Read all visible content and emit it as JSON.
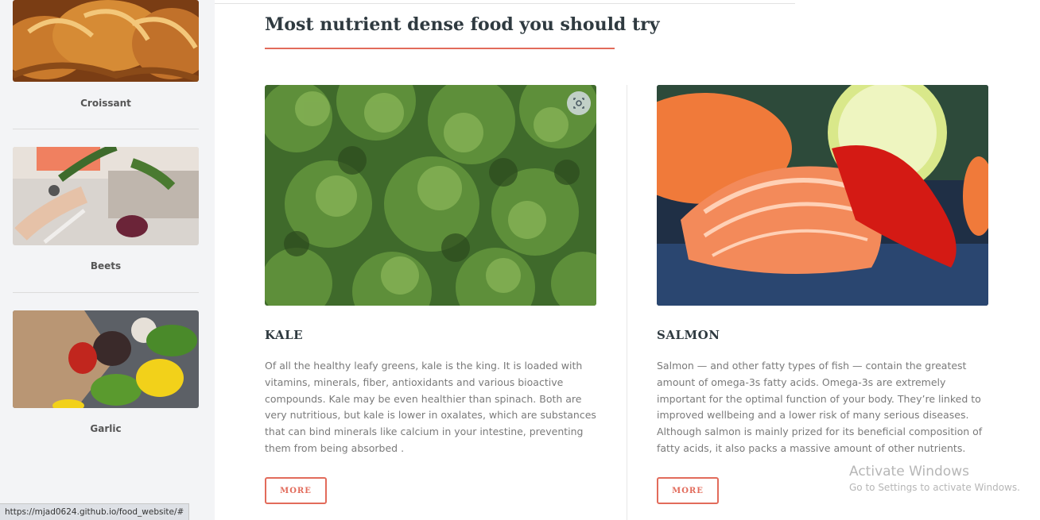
{
  "sidebar": {
    "items": [
      {
        "label": "Croissant",
        "image": "croissant-photo"
      },
      {
        "label": "Beets",
        "image": "beets-photo"
      },
      {
        "label": "Garlic",
        "image": "garlic-photo"
      }
    ]
  },
  "main": {
    "section_title": "Most nutrient dense food you should try",
    "cards": [
      {
        "title": "KALE",
        "image": "kale-photo",
        "text": "Of all the healthy leafy greens, kale is the king. It is loaded with vitamins, minerals, fiber, antioxidants and various bioactive compounds. Kale may be even healthier than spinach. Both are very nutritious, but kale is lower in oxalates, which are substances that can bind minerals like calcium in your intestine, preventing them from being absorbed .",
        "button": "MORE"
      },
      {
        "title": "SALMON",
        "image": "salmon-photo",
        "text": "Salmon — and other fatty types of fish — contain the greatest amount of omega-3s fatty acids. Omega-3s are extremely important for the optimal function of your body. They’re linked to improved wellbeing and a lower risk of many serious diseases. Although salmon is mainly prized for its beneficial composition of fatty acids, it also packs a massive amount of other nutrients.",
        "button": "MORE"
      }
    ]
  },
  "overlay": {
    "activate_title": "Activate Windows",
    "activate_sub": "Go to Settings to activate Windows."
  },
  "statusbar": {
    "url": "https://mjad0624.github.io/food_website/#"
  },
  "colors": {
    "accent": "#e26b5b",
    "sidebar_bg": "#f3f4f6",
    "heading": "#2f3a40",
    "body_text": "#7a7a7a"
  }
}
